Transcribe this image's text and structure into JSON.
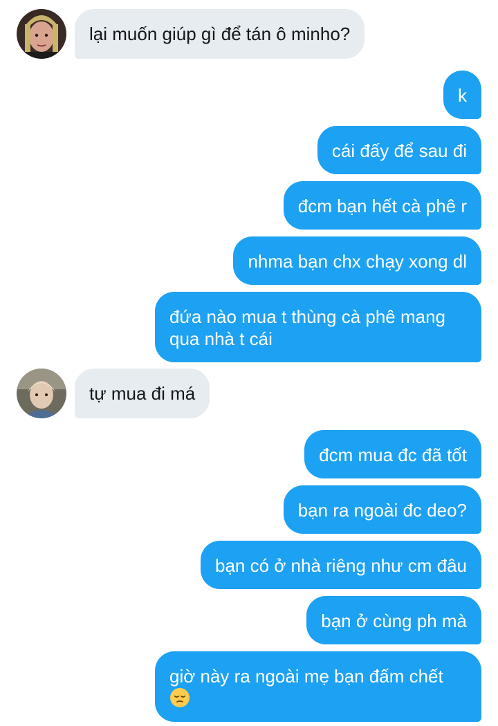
{
  "conversation": {
    "messages": [
      {
        "side": "incoming",
        "avatar": "avatar-1",
        "text": "lại muốn giúp gì để tán ô minho?"
      },
      {
        "side": "outgoing",
        "text": "k"
      },
      {
        "side": "outgoing",
        "text": "cái đấy để sau đi"
      },
      {
        "side": "outgoing",
        "text": "đcm bạn hết cà phê r"
      },
      {
        "side": "outgoing",
        "text": "nhma bạn chx chạy xong dl"
      },
      {
        "side": "outgoing",
        "text": "đứa nào mua t thùng cà phê mang qua nhà t cái"
      },
      {
        "side": "incoming",
        "avatar": "avatar-2",
        "text": "tự mua đi má"
      },
      {
        "side": "outgoing",
        "text": "đcm mua đc đã tốt"
      },
      {
        "side": "outgoing",
        "text": "bạn ra ngoài đc deo?"
      },
      {
        "side": "outgoing",
        "text": "bạn có ở nhà riêng như cm đâu"
      },
      {
        "side": "outgoing",
        "text": "bạn ở cùng ph mà"
      },
      {
        "side": "outgoing",
        "text": "giờ này ra ngoài mẹ bạn đấm chết",
        "emoji": "pensive-face-emoji"
      }
    ]
  },
  "colors": {
    "outgoing_bubble": "#1da1f2",
    "incoming_bubble": "#e6ecf0",
    "outgoing_text": "#ffffff",
    "incoming_text": "#14171a"
  }
}
